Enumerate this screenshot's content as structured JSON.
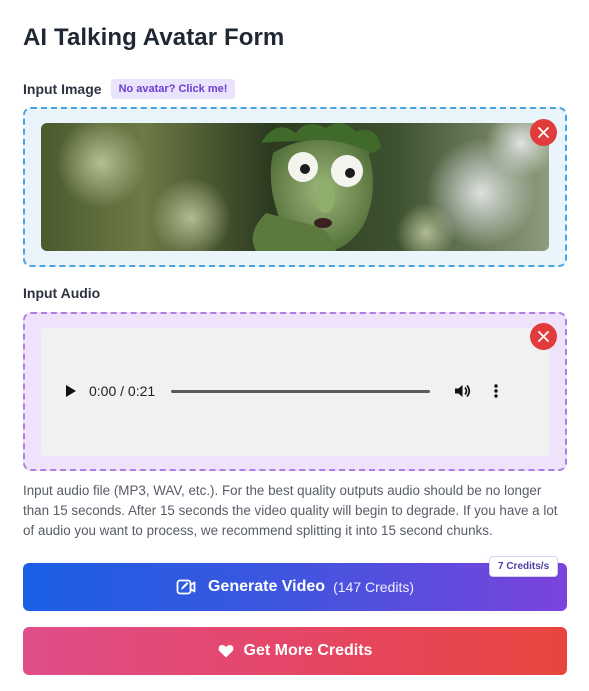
{
  "form": {
    "title": "AI Talking Avatar Form"
  },
  "input_image": {
    "label": "Input Image",
    "badge": "No avatar? Click me!"
  },
  "input_audio": {
    "label": "Input Audio",
    "time_display": "0:00 / 0:21",
    "progress": 0.0,
    "help_text": "Input audio file (MP3, WAV, etc.). For the best quality outputs audio should be no longer than 15 seconds. After 15 seconds the video quality will begin to degrade. If you have a lot of audio you want to process, we recommend splitting it into 15 second chunks."
  },
  "generate": {
    "label": "Generate Video",
    "cost": "(147 Credits)",
    "rate_badge": "7 Credits/s",
    "icon": "video-edit-icon"
  },
  "credits": {
    "label": "Get More Credits",
    "icon": "heart-icon"
  },
  "colors": {
    "image_border": "#4aa3df",
    "audio_border": "#b07ee0",
    "close": "#e23b3b",
    "generate_start": "#1a5fe4",
    "generate_end": "#7b43dd",
    "credits_start": "#e04d8a",
    "credits_end": "#e7463e"
  }
}
